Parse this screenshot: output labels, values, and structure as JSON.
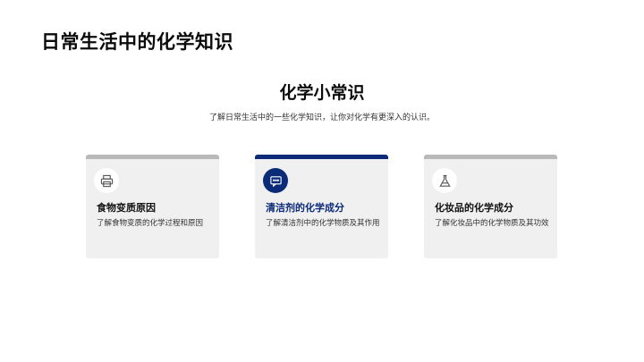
{
  "slide": {
    "title": "日常生活中的化学知识"
  },
  "section": {
    "title": "化学小常识",
    "subtitle": "了解日常生活中的一些化学知识，让你对化学有更深入的认识。"
  },
  "cards": [
    {
      "icon": "printer-icon",
      "title": "食物变质原因",
      "description": "了解食物变质的化学过程和原因",
      "active": false
    },
    {
      "icon": "chat-icon",
      "title": "清洁剂的化学成分",
      "description": "了解清洁剂中的化学物质及其作用",
      "active": true
    },
    {
      "icon": "flask-icon",
      "title": "化妆品的化学成分",
      "description": "了解化妆品中的化学物质及其功效",
      "active": false
    }
  ],
  "colors": {
    "accent": "#0b2a78",
    "card_bg": "#f0f0f0",
    "bar_inactive": "#b9b9b9"
  }
}
